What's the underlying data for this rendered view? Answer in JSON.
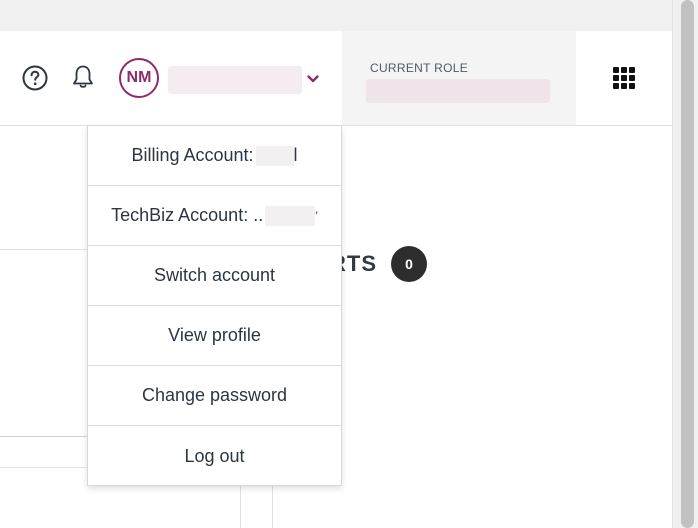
{
  "header": {
    "help_icon": "help-circle-icon",
    "notifications_icon": "bell-icon",
    "user": {
      "initials": "NM",
      "dropdown_icon": "chevron-down-icon"
    },
    "role": {
      "label": "CURRENT ROLE"
    },
    "apps_icon": "apps-grid-icon"
  },
  "main": {
    "alerts_heading_visible": "RTS",
    "alerts_count": "0"
  },
  "account_menu": {
    "items": [
      {
        "label": "Billing Account:",
        "suffix": "l"
      },
      {
        "label": "TechBiz Account: ..",
        "suffix": "’"
      },
      {
        "label": "Switch account"
      },
      {
        "label": "View profile"
      },
      {
        "label": "Change password"
      },
      {
        "label": "Log out"
      }
    ]
  },
  "colors": {
    "brand": "#8e2a6d",
    "text": "#2b3642",
    "badge": "#2d2d2d"
  }
}
